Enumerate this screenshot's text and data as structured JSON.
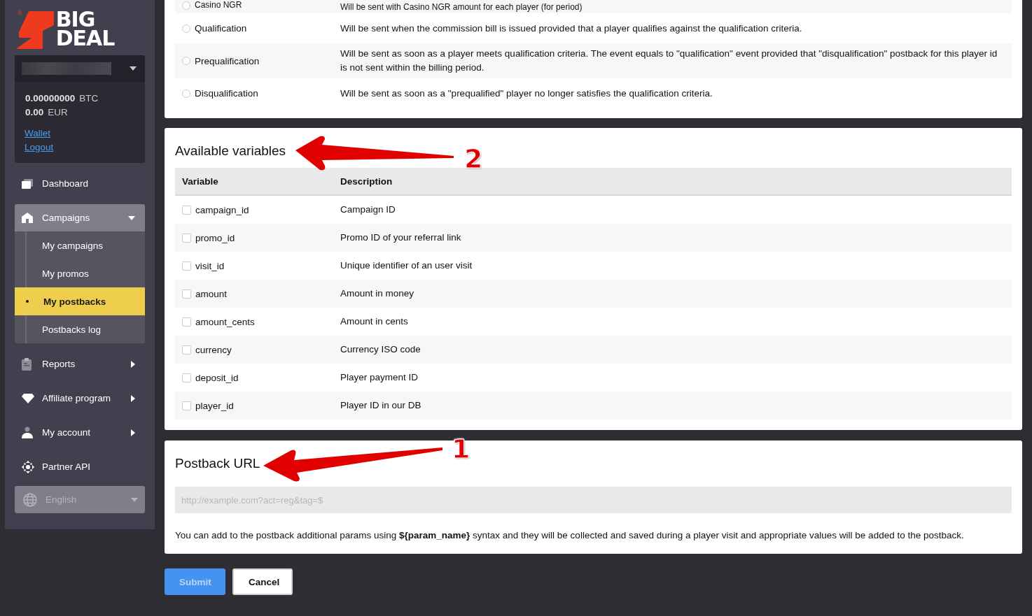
{
  "sidebar": {
    "logo": {
      "mark": "®",
      "lines": [
        "BIG",
        "DEAL"
      ]
    },
    "balances": [
      {
        "amount": "0.00000000",
        "currency": "BTC"
      },
      {
        "amount": "0.00",
        "currency": "EUR"
      }
    ],
    "links": [
      "Wallet",
      "Logout"
    ],
    "nav": [
      {
        "label": "Dashboard"
      },
      {
        "label": "Campaigns",
        "expanded": true,
        "children": [
          {
            "label": "My campaigns",
            "selected": false
          },
          {
            "label": "My promos",
            "selected": false
          },
          {
            "label": "My postbacks",
            "selected": true
          },
          {
            "label": "Postbacks log",
            "selected": false
          }
        ]
      },
      {
        "label": "Reports",
        "expanded": false
      },
      {
        "label": "Affiliate program",
        "expanded": false
      },
      {
        "label": "My account",
        "expanded": false
      },
      {
        "label": "Partner API"
      }
    ],
    "language": {
      "value": "English"
    }
  },
  "events": [
    {
      "name": "Casino NGR",
      "description": "Will be sent with Casino NGR amount for each player (for period)",
      "selected": false
    },
    {
      "name": "Qualification",
      "description": "Will be sent when the commission bill is issued provided that a player qualifies against the qualification criteria.",
      "selected": false
    },
    {
      "name": "Prequalification",
      "description": "Will be sent as soon as a player meets qualification criteria. The event equals to \"qualification\" event provided that \"disqualification\" postback for this player id is not sent within the billing period.",
      "selected": false
    },
    {
      "name": "Disqualification",
      "description": "Will be sent as soon as a \"prequalified\" player no longer satisfies the qualification criteria.",
      "selected": false
    }
  ],
  "variables": {
    "title": "Available variables",
    "columns": [
      "Variable",
      "Description"
    ],
    "rows": [
      {
        "name": "campaign_id",
        "description": "Campaign ID",
        "checked": false
      },
      {
        "name": "promo_id",
        "description": "Promo ID of your referral link",
        "checked": false
      },
      {
        "name": "visit_id",
        "description": "Unique identifier of an user visit",
        "checked": false
      },
      {
        "name": "amount",
        "description": "Amount in money",
        "checked": false
      },
      {
        "name": "amount_cents",
        "description": "Amount in cents",
        "checked": false
      },
      {
        "name": "currency",
        "description": "Currency ISO code",
        "checked": false
      },
      {
        "name": "deposit_id",
        "description": "Player payment ID",
        "checked": false
      },
      {
        "name": "player_id",
        "description": "Player ID in our DB",
        "checked": false
      }
    ]
  },
  "postback": {
    "title": "Postback URL",
    "placeholder": "http://example.com?act=reg&tag=$",
    "hint": "You can add to the postback additional params using **${param_name}** syntax and they will be collected and saved during a player visit and appropriate values will be added to the postback."
  },
  "buttons": [
    {
      "label": "Submit",
      "kind": "primary",
      "disabled": true
    },
    {
      "label": "Cancel",
      "kind": "secondary",
      "disabled": false
    }
  ],
  "annotations": [
    {
      "label": "2"
    },
    {
      "label": "1"
    }
  ]
}
